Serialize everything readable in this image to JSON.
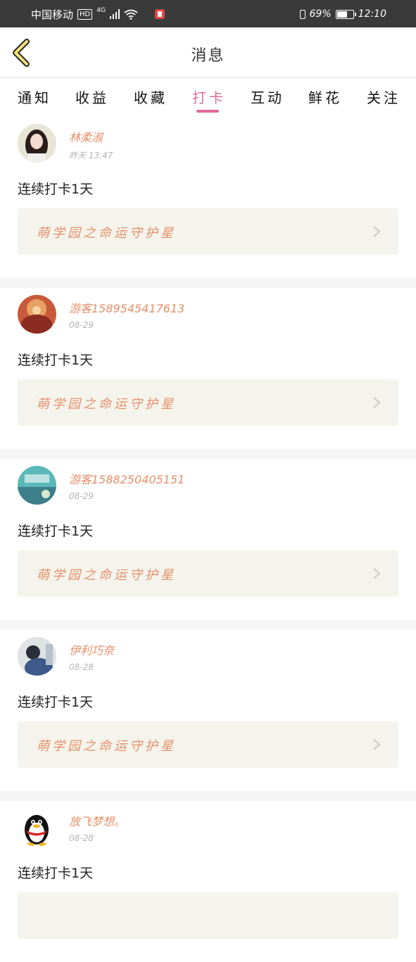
{
  "status_bar": {
    "carrier": "中国移动",
    "hd": "HD",
    "network": "4G",
    "battery_percent": "69%",
    "battery_level": 0.69,
    "time": "12:10"
  },
  "header": {
    "title": "消息",
    "back_icon": "chevron-left-icon"
  },
  "tabs": [
    "通知",
    "收益",
    "收藏",
    "打卡",
    "互动",
    "鲜花",
    "关注"
  ],
  "active_tab": "打卡",
  "items": [
    {
      "name": "林柔淑",
      "time": "昨天 13:47",
      "text": "连续打卡1天",
      "link": "萌学园之命运守护星"
    },
    {
      "name": "游客1589545417613",
      "time": "08-29",
      "text": "连续打卡1天",
      "link": "萌学园之命运守护星"
    },
    {
      "name": "游客1588250405151",
      "time": "08-29",
      "text": "连续打卡1天",
      "link": "萌学园之命运守护星"
    },
    {
      "name": "伊利巧奈",
      "time": "08-28",
      "text": "连续打卡1天",
      "link": "萌学园之命运守护星"
    },
    {
      "name": "放飞梦想。",
      "time": "08-28",
      "text": "连续打卡1天",
      "link": ""
    }
  ],
  "colors": {
    "accent_pink": "#e06a9a",
    "name_orange": "#e7906a",
    "link_box_bg": "#f4f4ec",
    "back_icon_yellow": "#f6e27a"
  }
}
